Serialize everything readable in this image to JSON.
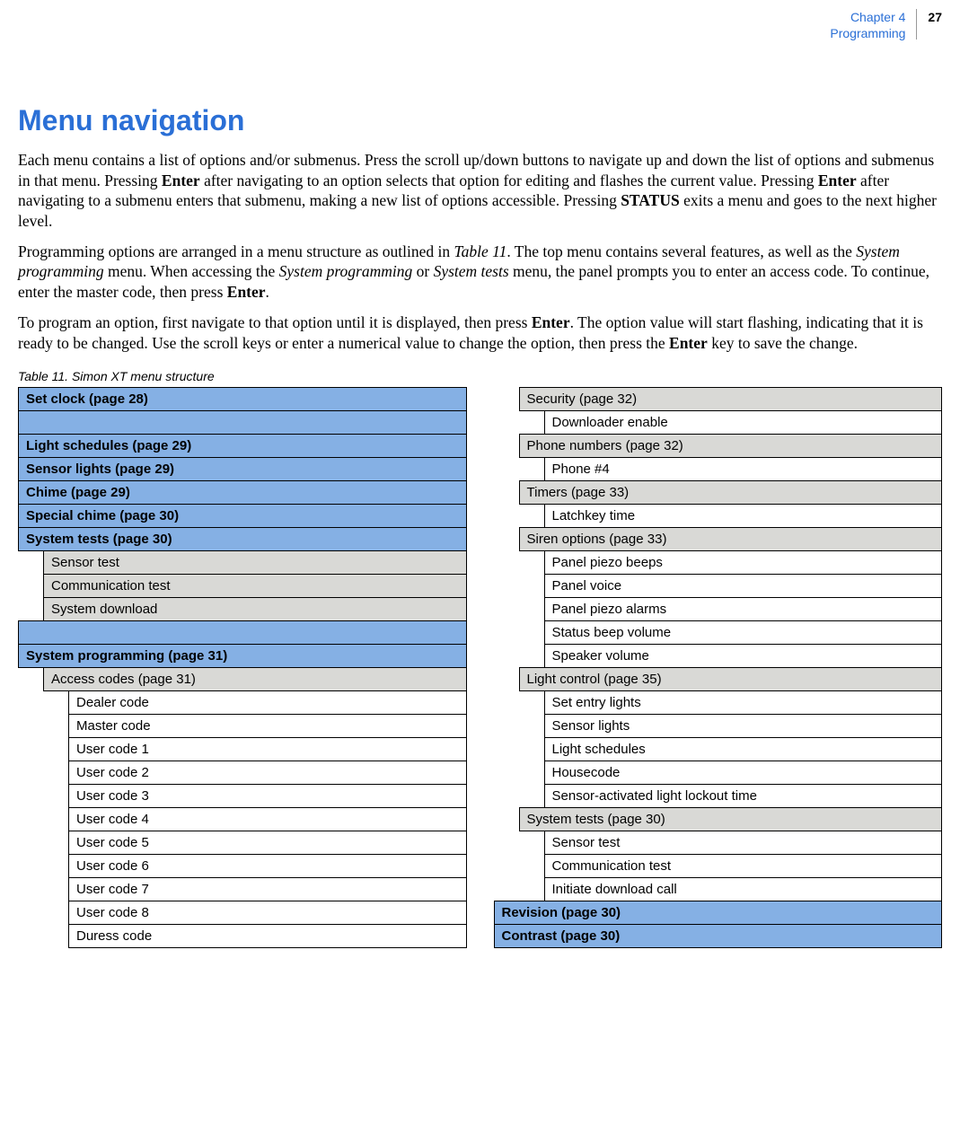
{
  "header": {
    "chapter": "Chapter 4",
    "section": "Programming",
    "page_number": "27"
  },
  "title": "Menu navigation",
  "paragraphs": {
    "p1_a": "Each menu contains a list of options and/or submenus. Press the scroll up/down buttons to navigate up and down the list of options and submenus in that menu. Pressing ",
    "p1_b": "Enter",
    "p1_c": " after navigating to an option selects that option for editing and flashes the current value. Pressing ",
    "p1_d": "Enter",
    "p1_e": " after navigating to a submenu enters that submenu, making a new list of options accessible. Pressing ",
    "p1_f": "STATUS",
    "p1_g": " exits a menu and goes to the next higher level.",
    "p2_a": "Programming options are arranged in a menu structure as outlined in ",
    "p2_b": "Table 11",
    "p2_c": ". The top menu contains several features, as well as the ",
    "p2_d": "System programming",
    "p2_e": " menu. When accessing the ",
    "p2_f": "System programming",
    "p2_g": " or ",
    "p2_h": "System tests",
    "p2_i": " menu, the panel prompts you to enter an access code. To continue, enter the master code, then press ",
    "p2_j": "Enter",
    "p2_k": ".",
    "p3_a": "To program an option, first navigate to that option until it is displayed, then press ",
    "p3_b": "Enter",
    "p3_c": ". The option value will start flashing, indicating that it is ready to be changed. Use the scroll keys or enter a numerical value to change the option, then press the ",
    "p3_d": "Enter",
    "p3_e": " key to save the change."
  },
  "table_caption": "Table 11.   Simon XT  menu structure",
  "left_column": [
    {
      "level": 0,
      "class": "blue",
      "text": "Set clock (page 28)"
    },
    {
      "level": 0,
      "class": "blue",
      "text": ""
    },
    {
      "level": 0,
      "class": "blue",
      "text": "Light schedules (page 29)"
    },
    {
      "level": 0,
      "class": "blue",
      "text": "Sensor lights (page 29)"
    },
    {
      "level": 0,
      "class": "blue",
      "text": "Chime (page 29)"
    },
    {
      "level": 0,
      "class": "blue",
      "text": "Special chime (page 30)"
    },
    {
      "level": 0,
      "class": "blue",
      "text": "System tests (page 30)"
    },
    {
      "level": 1,
      "class": "gray",
      "text": "Sensor test"
    },
    {
      "level": 1,
      "class": "gray",
      "text": "Communication test"
    },
    {
      "level": 1,
      "class": "gray",
      "text": "System download"
    },
    {
      "level": 0,
      "class": "blue",
      "text": ""
    },
    {
      "level": 0,
      "class": "blue",
      "text": "System programming (page 31)"
    },
    {
      "level": 1,
      "class": "gray",
      "text": "Access codes (page 31)"
    },
    {
      "level": 2,
      "class": "white",
      "text": "Dealer code"
    },
    {
      "level": 2,
      "class": "white",
      "text": "Master code"
    },
    {
      "level": 2,
      "class": "white",
      "text": "User code 1"
    },
    {
      "level": 2,
      "class": "white",
      "text": "User code 2"
    },
    {
      "level": 2,
      "class": "white",
      "text": "User code 3"
    },
    {
      "level": 2,
      "class": "white",
      "text": "User code 4"
    },
    {
      "level": 2,
      "class": "white",
      "text": "User code 5"
    },
    {
      "level": 2,
      "class": "white",
      "text": "User code 6"
    },
    {
      "level": 2,
      "class": "white",
      "text": "User code 7"
    },
    {
      "level": 2,
      "class": "white",
      "text": "User code 8"
    },
    {
      "level": 2,
      "class": "white",
      "text": "Duress code"
    }
  ],
  "right_column": [
    {
      "level": 1,
      "class": "gray",
      "text": "Security (page 32)"
    },
    {
      "level": 2,
      "class": "white",
      "text": "Downloader enable"
    },
    {
      "level": 1,
      "class": "gray",
      "text": "Phone numbers (page 32)"
    },
    {
      "level": 2,
      "class": "white",
      "text": "Phone #4"
    },
    {
      "level": 1,
      "class": "gray",
      "text": "Timers (page 33)"
    },
    {
      "level": 2,
      "class": "white",
      "text": "Latchkey time"
    },
    {
      "level": 1,
      "class": "gray",
      "text": "Siren options (page 33)"
    },
    {
      "level": 2,
      "class": "white",
      "text": "Panel piezo beeps"
    },
    {
      "level": 2,
      "class": "white",
      "text": "Panel voice"
    },
    {
      "level": 2,
      "class": "white",
      "text": "Panel piezo alarms"
    },
    {
      "level": 2,
      "class": "white",
      "text": "Status beep volume"
    },
    {
      "level": 2,
      "class": "white",
      "text": "Speaker volume"
    },
    {
      "level": 1,
      "class": "gray",
      "text": "Light control (page 35)"
    },
    {
      "level": 2,
      "class": "white",
      "text": "Set entry lights"
    },
    {
      "level": 2,
      "class": "white",
      "text": "Sensor lights"
    },
    {
      "level": 2,
      "class": "white",
      "text": "Light schedules"
    },
    {
      "level": 2,
      "class": "white",
      "text": "Housecode"
    },
    {
      "level": 2,
      "class": "white",
      "text": "Sensor-activated light lockout time"
    },
    {
      "level": 1,
      "class": "gray",
      "text": "System tests (page 30)"
    },
    {
      "level": 2,
      "class": "white",
      "text": "Sensor test"
    },
    {
      "level": 2,
      "class": "white",
      "text": "Communication test"
    },
    {
      "level": 2,
      "class": "white",
      "text": "Initiate download call"
    },
    {
      "level": 0,
      "class": "blue",
      "text": "Revision (page 30)"
    },
    {
      "level": 0,
      "class": "blue",
      "text": "Contrast (page 30)"
    }
  ]
}
